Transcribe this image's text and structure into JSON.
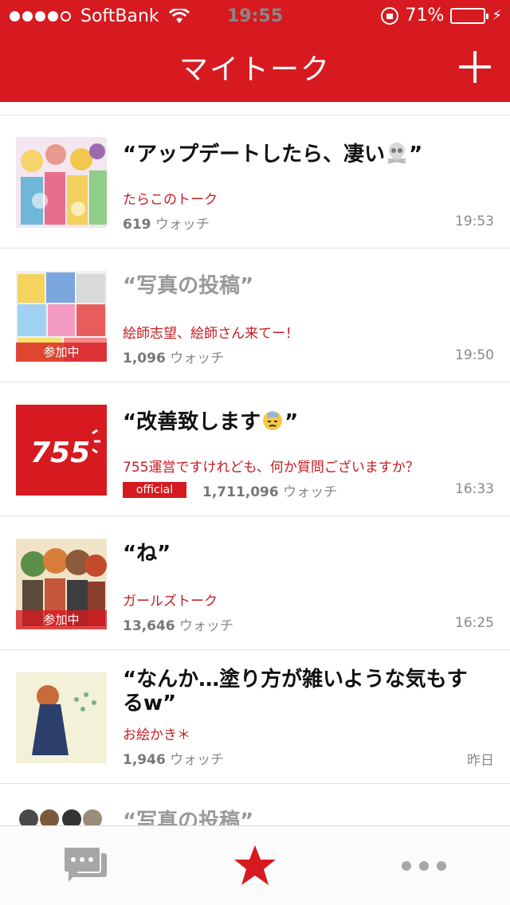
{
  "status": {
    "carrier": "SoftBank",
    "time": "19:55",
    "battery": "71%",
    "battery_level": 0.71,
    "signal_bars": 4
  },
  "nav": {
    "title": "マイトーク",
    "add_label": "+"
  },
  "talks": [
    {
      "title": "“アップデートしたら、凄い",
      "emoji": "skull",
      "subtitle": "たらこのトーク",
      "watch_count": "619",
      "watch_label": "ウォッチ",
      "time": "19:53",
      "joined": false,
      "official": false
    },
    {
      "title": "“写真の投稿”",
      "subtitle": "絵師志望、絵師さん来てー！",
      "watch_count": "1,096",
      "watch_label": "ウォッチ",
      "time": "19:50",
      "joined": true,
      "joined_label": "参加中",
      "official": false
    },
    {
      "title": "“改善致します",
      "emoji": "sweat-face",
      "subtitle": "755運営ですけれども、何か質問ございますか？",
      "watch_count": "1,711,096",
      "watch_label": "ウォッチ",
      "time": "16:33",
      "joined": false,
      "official": true,
      "official_label": "official",
      "thumb_text": "755"
    },
    {
      "title": "“ね”",
      "subtitle": "ガールズトーク",
      "watch_count": "13,646",
      "watch_label": "ウォッチ",
      "time": "16:25",
      "joined": true,
      "joined_label": "参加中",
      "official": false
    },
    {
      "title": "“なんか…塗り方が雑いような気もするw”",
      "subtitle": "お絵かき＊",
      "watch_count": "1,946",
      "watch_label": "ウォッチ",
      "time": "昨日",
      "joined": false,
      "official": false
    },
    {
      "title": "“写真の投稿”"
    }
  ],
  "colors": {
    "brand": "#d71a20",
    "subtitle": "#c61b22",
    "text_muted": "#888888"
  },
  "tabbar": {
    "items": [
      "chat-icon",
      "star-icon",
      "more-icon"
    ],
    "active": "star-icon"
  }
}
